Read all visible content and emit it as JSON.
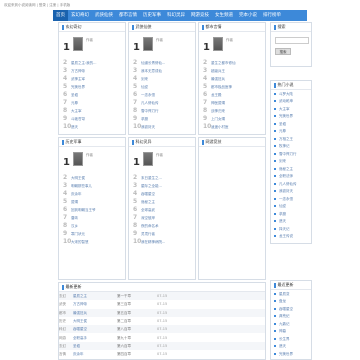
{
  "topbar": {
    "text": "欢迎来到小说阅读网 | 登录 | 注册 | 手机版"
  },
  "nav": {
    "items": [
      "首页",
      "玄幻奇幻",
      "武侠仙侠",
      "都市言情",
      "历史军事",
      "科幻灵异",
      "网游竞技",
      "女生频道",
      "完本小说",
      "排行榜单"
    ]
  },
  "col1": {
    "title": "玄幻奇幻",
    "top": {
      "num": "1",
      "meta": "作者"
    },
    "items": [
      {
        "n": "2",
        "t": "星辰之主:我的..."
      },
      {
        "n": "3",
        "t": "万古神帝"
      },
      {
        "n": "4",
        "t": "武神主宰"
      },
      {
        "n": "5",
        "t": "完美世界"
      },
      {
        "n": "6",
        "t": "圣墟"
      },
      {
        "n": "7",
        "t": "元尊"
      },
      {
        "n": "8",
        "t": "大主宰"
      },
      {
        "n": "9",
        "t": "斗破苍穹"
      },
      {
        "n": "10",
        "t": "遮天"
      }
    ]
  },
  "col2": {
    "title": "武侠仙侠",
    "top": {
      "num": "1",
      "meta": "作者"
    },
    "items": [
      {
        "n": "2",
        "t": "仙道长青修仙..."
      },
      {
        "n": "3",
        "t": "我本无意成仙"
      },
      {
        "n": "4",
        "t": "剑来"
      },
      {
        "n": "5",
        "t": "仙逆"
      },
      {
        "n": "6",
        "t": "一念永恒"
      },
      {
        "n": "7",
        "t": "凡人修仙传"
      },
      {
        "n": "8",
        "t": "雪中悍刀行"
      },
      {
        "n": "9",
        "t": "求魔"
      },
      {
        "n": "10",
        "t": "我欲封天"
      }
    ]
  },
  "col3": {
    "title": "都市言情",
    "top": {
      "num": "1",
      "meta": "作者"
    },
    "items": [
      {
        "n": "2",
        "t": "重生之都市修仙"
      },
      {
        "n": "3",
        "t": "超级兵王"
      },
      {
        "n": "4",
        "t": "最强狂兵"
      },
      {
        "n": "5",
        "t": "都市极品医神"
      },
      {
        "n": "6",
        "t": "龙王殿"
      },
      {
        "n": "7",
        "t": "神医赘婿"
      },
      {
        "n": "8",
        "t": "战神归来"
      },
      {
        "n": "9",
        "t": "上门女婿"
      },
      {
        "n": "10",
        "t": "逍遥小村医"
      }
    ]
  },
  "col4": {
    "title": "历史军事",
    "top": {
      "num": "1",
      "meta": "作者"
    },
    "items": [
      {
        "n": "2",
        "t": "大明王侯"
      },
      {
        "n": "3",
        "t": "明朝那些事儿"
      },
      {
        "n": "4",
        "t": "庆余年"
      },
      {
        "n": "5",
        "t": "赘婿"
      },
      {
        "n": "6",
        "t": "回到明朝当王爷"
      },
      {
        "n": "7",
        "t": "唐砖"
      },
      {
        "n": "8",
        "t": "汉乡"
      },
      {
        "n": "9",
        "t": "寒门状元"
      },
      {
        "n": "10",
        "t": "大宋的智慧"
      }
    ]
  },
  "col5": {
    "title": "科幻灵异",
    "top": {
      "num": "1",
      "meta": "作者"
    },
    "items": [
      {
        "n": "2",
        "t": "末日重生之..."
      },
      {
        "n": "3",
        "t": "星际之全能..."
      },
      {
        "n": "4",
        "t": "吞噬星空"
      },
      {
        "n": "5",
        "t": "诡秘之主"
      },
      {
        "n": "6",
        "t": "全球高武"
      },
      {
        "n": "7",
        "t": "深空彼岸"
      },
      {
        "n": "8",
        "t": "夜的命名术"
      },
      {
        "n": "9",
        "t": "灵境行者"
      },
      {
        "n": "10",
        "t": "我在精神病院..."
      }
    ]
  },
  "col6": {
    "title": "网游竞技"
  },
  "search": {
    "title": "搜索",
    "placeholder": "",
    "button": "搜索"
  },
  "hot": {
    "title": "热门小说",
    "items": [
      "斗罗大陆",
      "武动乾坤",
      "大主宰",
      "完美世界",
      "圣墟",
      "元尊",
      "万相之王",
      "牧神记",
      "雪中悍刀行",
      "剑来",
      "诡秘之主",
      "全职法师",
      "凡人修仙传",
      "我欲封天",
      "一念永恒",
      "仙逆",
      "求魔",
      "遮天",
      "择天记",
      "龙王传说"
    ]
  },
  "recent": {
    "title": "最近更新",
    "items": [
      "星辰变",
      "盘龙",
      "吞噬星空",
      "莽荒纪",
      "九鼎记",
      "神墓",
      "长生界",
      "遮天",
      "完美世界",
      "圣墟"
    ]
  },
  "updates": {
    "title": "最新更新",
    "rows": [
      {
        "c1": "玄幻",
        "c2": "星辰之主",
        "c3": "第一千章",
        "c4": "07-15"
      },
      {
        "c1": "武侠",
        "c2": "万古神帝",
        "c3": "第三百章",
        "c4": "07-15"
      },
      {
        "c1": "都市",
        "c2": "最强狂兵",
        "c3": "第五百章",
        "c4": "07-15"
      },
      {
        "c1": "历史",
        "c2": "大明王侯",
        "c3": "第二百章",
        "c4": "07-15"
      },
      {
        "c1": "科幻",
        "c2": "吞噬星空",
        "c3": "第八百章",
        "c4": "07-15"
      },
      {
        "c1": "网游",
        "c2": "全职高手",
        "c3": "第九十章",
        "c4": "07-15"
      },
      {
        "c1": "玄幻",
        "c2": "圣墟",
        "c3": "第六百章",
        "c4": "07-15"
      },
      {
        "c1": "言情",
        "c2": "庆余年",
        "c3": "第四百章",
        "c4": "07-15"
      },
      {
        "c1": "仙侠",
        "c2": "剑来",
        "c3": "第七百章",
        "c4": "07-15"
      }
    ]
  }
}
